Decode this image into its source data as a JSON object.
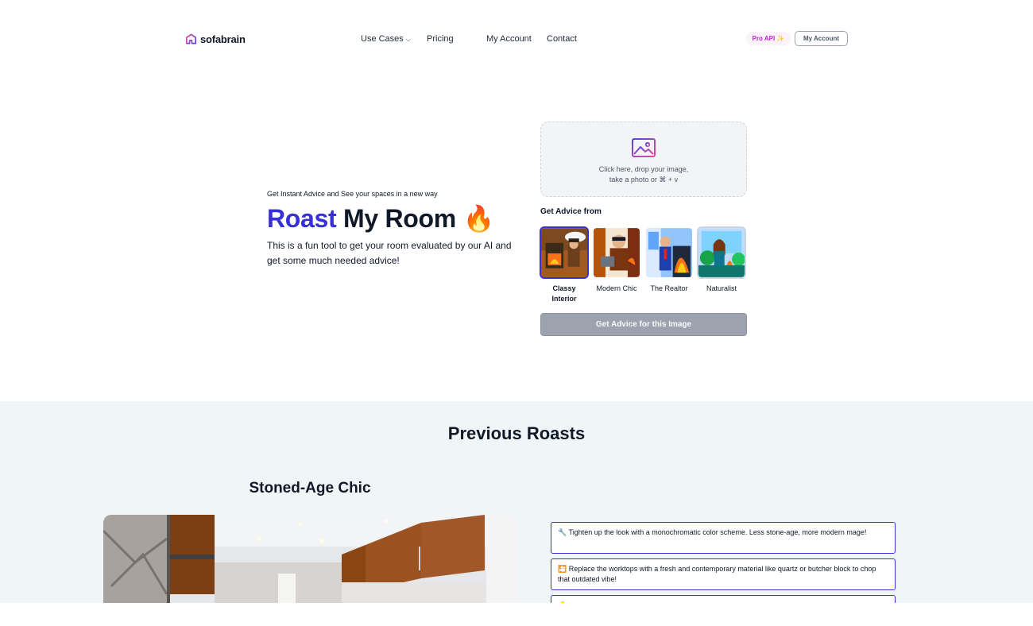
{
  "nav": {
    "logo_text": "sofabrain",
    "links": [
      {
        "label": "Use Cases",
        "has_dropdown": true
      },
      {
        "label": "Pricing"
      },
      {
        "label": "My Account"
      },
      {
        "label": "Contact"
      }
    ],
    "pro_api_label": "Pro API ✨",
    "my_account_button": "My Account"
  },
  "hero": {
    "kicker": "Get Instant Advice and See your spaces in a new way",
    "title_accent": "Roast",
    "title_rest": " My Room ",
    "title_emoji": "🔥",
    "description": "This is a fun tool to get your room evaluated by our AI and get some much needed advice!"
  },
  "upload": {
    "line1": "Click here, drop your image,",
    "line2": "take a photo or ⌘ + v"
  },
  "advice": {
    "label": "Get Advice from",
    "personas": [
      {
        "label": "Classy Interior",
        "selected": true
      },
      {
        "label": "Modern Chic",
        "selected": false
      },
      {
        "label": "The Realtor",
        "selected": false
      },
      {
        "label": "Naturalist",
        "selected": false
      }
    ],
    "button_label": "Get Advice for this Image"
  },
  "previous": {
    "title": "Previous Roasts",
    "roast_title": "Stoned-Age Chic",
    "tips": [
      "🔧 Tighten up the look with a monochromatic color scheme. Less stone-age, more modern mage!",
      "🎦 Replace the worktops with a fresh and contemporary material like quartz or butcher block to chop that outdated vibe!",
      "💡"
    ]
  },
  "colors": {
    "accent": "#3730d6",
    "button_disabled": "#9ca3af",
    "section_bg": "#f0f5f8"
  }
}
